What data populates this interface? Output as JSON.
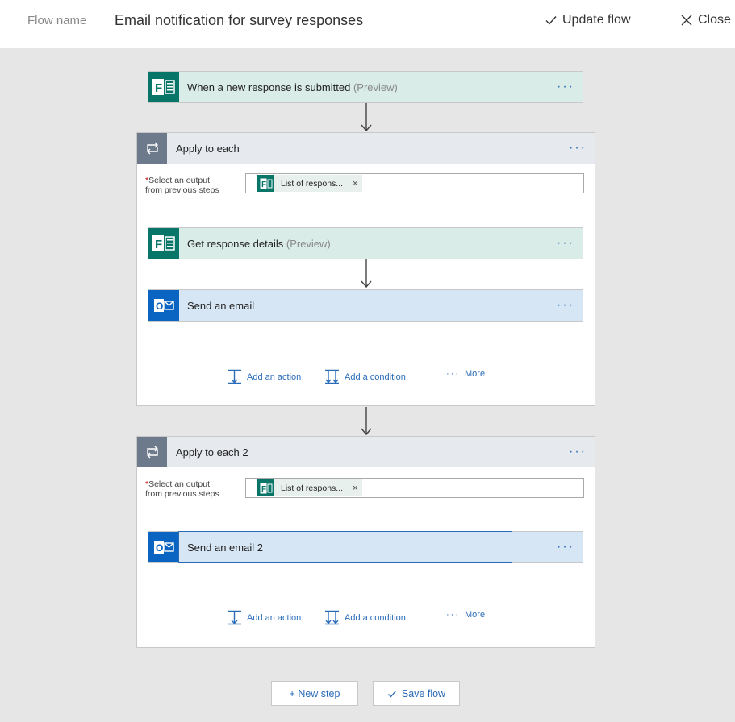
{
  "header": {
    "flow_name_label": "Flow name",
    "flow_name": "Email notification for survey responses",
    "update_label": "Update flow",
    "close_label": "Close"
  },
  "trigger": {
    "title": "When a new response is submitted",
    "preview": "(Preview)",
    "more": "···",
    "icon": "forms-icon"
  },
  "scope1": {
    "title": "Apply to each",
    "more": "···",
    "select_required": "*",
    "select_label_1": "Select an output",
    "select_label_2": "from previous steps",
    "token": "List of respons...",
    "token_remove": "×",
    "actions": [
      {
        "title": "Get response details",
        "preview": "(Preview)",
        "more": "···",
        "icon": "forms-icon"
      },
      {
        "title": "Send an email",
        "more": "···",
        "icon": "outlook-icon"
      }
    ],
    "add_action": "Add an action",
    "add_condition": "Add a condition",
    "more_label": "More"
  },
  "scope2": {
    "title": "Apply to each 2",
    "more": "···",
    "select_required": "*",
    "select_label_1": "Select an output",
    "select_label_2": "from previous steps",
    "token": "List of respons...",
    "token_remove": "×",
    "actions": [
      {
        "title": "Send an email 2",
        "more": "···",
        "icon": "outlook-icon"
      }
    ],
    "add_action": "Add an action",
    "add_condition": "Add a condition",
    "more_label": "More"
  },
  "footer": {
    "new_step": "+ New step",
    "save_flow": "Save flow"
  },
  "colors": {
    "forms": "#077568",
    "outlook": "#0a64c1",
    "link": "#2a6bb8",
    "loop": "#6d7a8c"
  }
}
